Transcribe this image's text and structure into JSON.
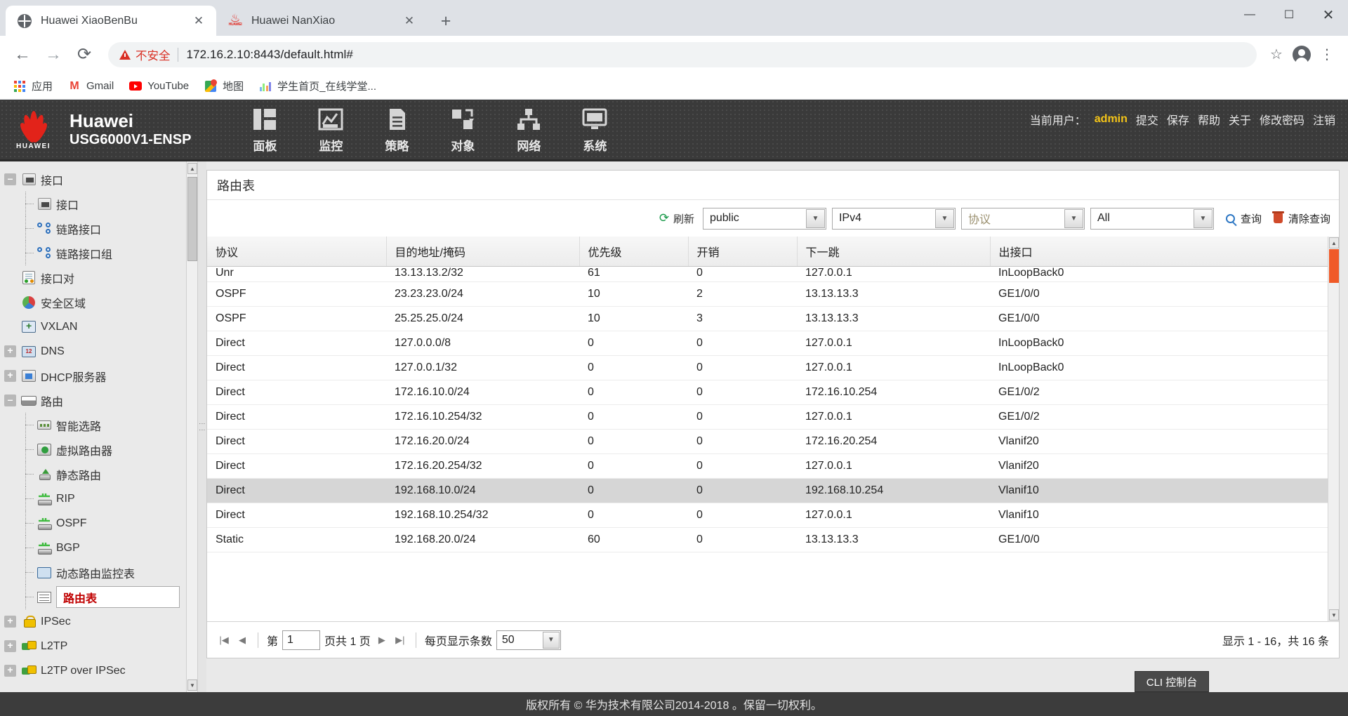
{
  "browser": {
    "tabs": [
      {
        "title": "Huawei XiaoBenBu",
        "favicon": "globe-icon",
        "active": true
      },
      {
        "title": "Huawei NanXiao",
        "favicon": "huawei-icon",
        "active": false
      }
    ],
    "new_tab_label": "+",
    "window_controls": {
      "minimize": "—",
      "maximize": "☐",
      "close": "✕"
    },
    "nav": {
      "back": "←",
      "forward": "→",
      "reload": "⟳"
    },
    "omnibox": {
      "security_label": "不安全",
      "url": "172.16.2.10:8443/default.html#",
      "star": "☆",
      "menu": "⋮"
    },
    "bookmarks": [
      {
        "label": "应用",
        "icon": "apps-grid-icon"
      },
      {
        "label": "Gmail",
        "icon": "gmail-icon"
      },
      {
        "label": "YouTube",
        "icon": "youtube-icon"
      },
      {
        "label": "地图",
        "icon": "maps-icon"
      },
      {
        "label": "学生首页_在线学堂...",
        "icon": "bars-icon"
      }
    ]
  },
  "header": {
    "brand_line1": "Huawei",
    "brand_line2": "USG6000V1-ENSP",
    "logo_word": "HUAWEI",
    "nav_items": [
      {
        "label": "面板",
        "icon": "dashboard-icon"
      },
      {
        "label": "监控",
        "icon": "monitor-chart-icon"
      },
      {
        "label": "策略",
        "icon": "policy-document-icon"
      },
      {
        "label": "对象",
        "icon": "object-icon"
      },
      {
        "label": "网络",
        "icon": "network-icon"
      },
      {
        "label": "系统",
        "icon": "system-screen-icon"
      }
    ],
    "user_prefix": "当前用户：",
    "user_name": "admin",
    "links": [
      "提交",
      "保存",
      "帮助",
      "关于",
      "修改密码",
      "注销"
    ]
  },
  "sidebar": {
    "items": [
      {
        "label": "接口",
        "icon": "port-icon",
        "toggle": "minus",
        "level": 0
      },
      {
        "label": "接口",
        "icon": "port-icon",
        "toggle": "none",
        "level": 1
      },
      {
        "label": "链路接口",
        "icon": "link-interface-icon",
        "toggle": "none",
        "level": 1
      },
      {
        "label": "链路接口组",
        "icon": "link-interface-group-icon",
        "toggle": "none",
        "level": 1
      },
      {
        "label": "接口对",
        "icon": "interface-pair-icon",
        "toggle": "none",
        "level": 0
      },
      {
        "label": "安全区域",
        "icon": "security-zone-pie-icon",
        "toggle": "none",
        "level": 0
      },
      {
        "label": "VXLAN",
        "icon": "vxlan-icon",
        "toggle": "none",
        "level": 0
      },
      {
        "label": "DNS",
        "icon": "dns-icon",
        "toggle": "plus",
        "level": 0
      },
      {
        "label": "DHCP服务器",
        "icon": "dhcp-server-icon",
        "toggle": "plus",
        "level": 0
      },
      {
        "label": "路由",
        "icon": "route-icon",
        "toggle": "minus",
        "level": 0
      },
      {
        "label": "智能选路",
        "icon": "smart-route-icon",
        "toggle": "none",
        "level": 1
      },
      {
        "label": "虚拟路由器",
        "icon": "virtual-router-icon",
        "toggle": "none",
        "level": 1
      },
      {
        "label": "静态路由",
        "icon": "static-route-icon",
        "toggle": "none",
        "level": 1
      },
      {
        "label": "RIP",
        "icon": "protocol-icon",
        "toggle": "none",
        "level": 1
      },
      {
        "label": "OSPF",
        "icon": "protocol-icon",
        "toggle": "none",
        "level": 1
      },
      {
        "label": "BGP",
        "icon": "protocol-icon",
        "toggle": "none",
        "level": 1
      },
      {
        "label": "动态路由监控表",
        "icon": "dynamic-route-monitor-icon",
        "toggle": "none",
        "level": 1
      },
      {
        "label": "路由表",
        "icon": "route-table-icon",
        "toggle": "none",
        "level": 1,
        "selected": true
      },
      {
        "label": "IPSec",
        "icon": "lock-icon",
        "toggle": "plus",
        "level": 0
      },
      {
        "label": "L2TP",
        "icon": "l2tp-icon",
        "toggle": "plus",
        "level": 0
      },
      {
        "label": "L2TP over IPSec",
        "icon": "l2tp-icon",
        "toggle": "plus",
        "level": 0
      }
    ]
  },
  "panel": {
    "title": "路由表",
    "toolbar": {
      "refresh_label": "刷新",
      "vrf_value": "public",
      "ip_version_value": "IPv4",
      "protocol_placeholder": "协议",
      "scope_value": "All",
      "query_label": "查询",
      "clear_query_label": "清除查询"
    },
    "columns": [
      "协议",
      "目的地址/掩码",
      "优先级",
      "开销",
      "下一跳",
      "出接口"
    ],
    "rows": [
      {
        "protocol": "Unr",
        "dest": "13.13.13.2/32",
        "pref": "61",
        "cost": "0",
        "nexthop": "127.0.0.1",
        "iface": "InLoopBack0",
        "clipped": true
      },
      {
        "protocol": "OSPF",
        "dest": "23.23.23.0/24",
        "pref": "10",
        "cost": "2",
        "nexthop": "13.13.13.3",
        "iface": "GE1/0/0"
      },
      {
        "protocol": "OSPF",
        "dest": "25.25.25.0/24",
        "pref": "10",
        "cost": "3",
        "nexthop": "13.13.13.3",
        "iface": "GE1/0/0"
      },
      {
        "protocol": "Direct",
        "dest": "127.0.0.0/8",
        "pref": "0",
        "cost": "0",
        "nexthop": "127.0.0.1",
        "iface": "InLoopBack0"
      },
      {
        "protocol": "Direct",
        "dest": "127.0.0.1/32",
        "pref": "0",
        "cost": "0",
        "nexthop": "127.0.0.1",
        "iface": "InLoopBack0"
      },
      {
        "protocol": "Direct",
        "dest": "172.16.10.0/24",
        "pref": "0",
        "cost": "0",
        "nexthop": "172.16.10.254",
        "iface": "GE1/0/2"
      },
      {
        "protocol": "Direct",
        "dest": "172.16.10.254/32",
        "pref": "0",
        "cost": "0",
        "nexthop": "127.0.0.1",
        "iface": "GE1/0/2"
      },
      {
        "protocol": "Direct",
        "dest": "172.16.20.0/24",
        "pref": "0",
        "cost": "0",
        "nexthop": "172.16.20.254",
        "iface": "Vlanif20"
      },
      {
        "protocol": "Direct",
        "dest": "172.16.20.254/32",
        "pref": "0",
        "cost": "0",
        "nexthop": "127.0.0.1",
        "iface": "Vlanif20"
      },
      {
        "protocol": "Direct",
        "dest": "192.168.10.0/24",
        "pref": "0",
        "cost": "0",
        "nexthop": "192.168.10.254",
        "iface": "Vlanif10",
        "alt": true
      },
      {
        "protocol": "Direct",
        "dest": "192.168.10.254/32",
        "pref": "0",
        "cost": "0",
        "nexthop": "127.0.0.1",
        "iface": "Vlanif10"
      },
      {
        "protocol": "Static",
        "dest": "192.168.20.0/24",
        "pref": "60",
        "cost": "0",
        "nexthop": "13.13.13.3",
        "iface": "GE1/0/0",
        "highlighted": true
      }
    ],
    "pager": {
      "first": "|◀",
      "prev": "◀",
      "next": "▶",
      "last": "▶|",
      "page_prefix": "第",
      "page_value": "1",
      "page_suffix": "页共 1 页",
      "per_page_label": "每页显示条数",
      "per_page_value": "50",
      "summary": "显示 1 - 16，共 16 条"
    },
    "cli_button": "CLI 控制台"
  },
  "footer": {
    "text": "版权所有 © 华为技术有限公司2014-2018 。保留一切权利。"
  }
}
